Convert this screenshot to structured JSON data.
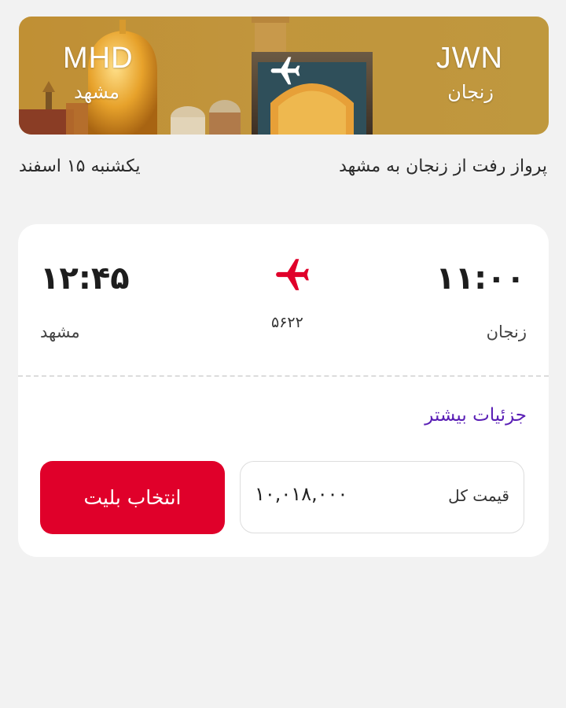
{
  "hero": {
    "origin_code": "JWN",
    "origin_city": "زنجان",
    "destination_code": "MHD",
    "destination_city": "مشهد"
  },
  "route": {
    "title": "پرواز رفت از زنجان به مشهد",
    "date": "یکشنبه ۱۵ اسفند"
  },
  "flight": {
    "departure_time": "۱۱:۰۰",
    "departure_city": "زنجان",
    "arrival_time": "۱۲:۴۵",
    "arrival_city": "مشهد",
    "flight_number": "۵۶۲۲",
    "details_label": "جزئیات بیشتر",
    "price_label": "قیمت کل",
    "price_value": "۱۰,۰۱۸,۰۰۰",
    "select_label": "انتخاب بلیت"
  },
  "colors": {
    "accent_red": "#e0002a",
    "link_purple": "#5a1fb5",
    "hero_gold": "#c9a044"
  },
  "icons": {
    "hero_plane": "airplane-icon",
    "card_plane": "airplane-icon"
  }
}
